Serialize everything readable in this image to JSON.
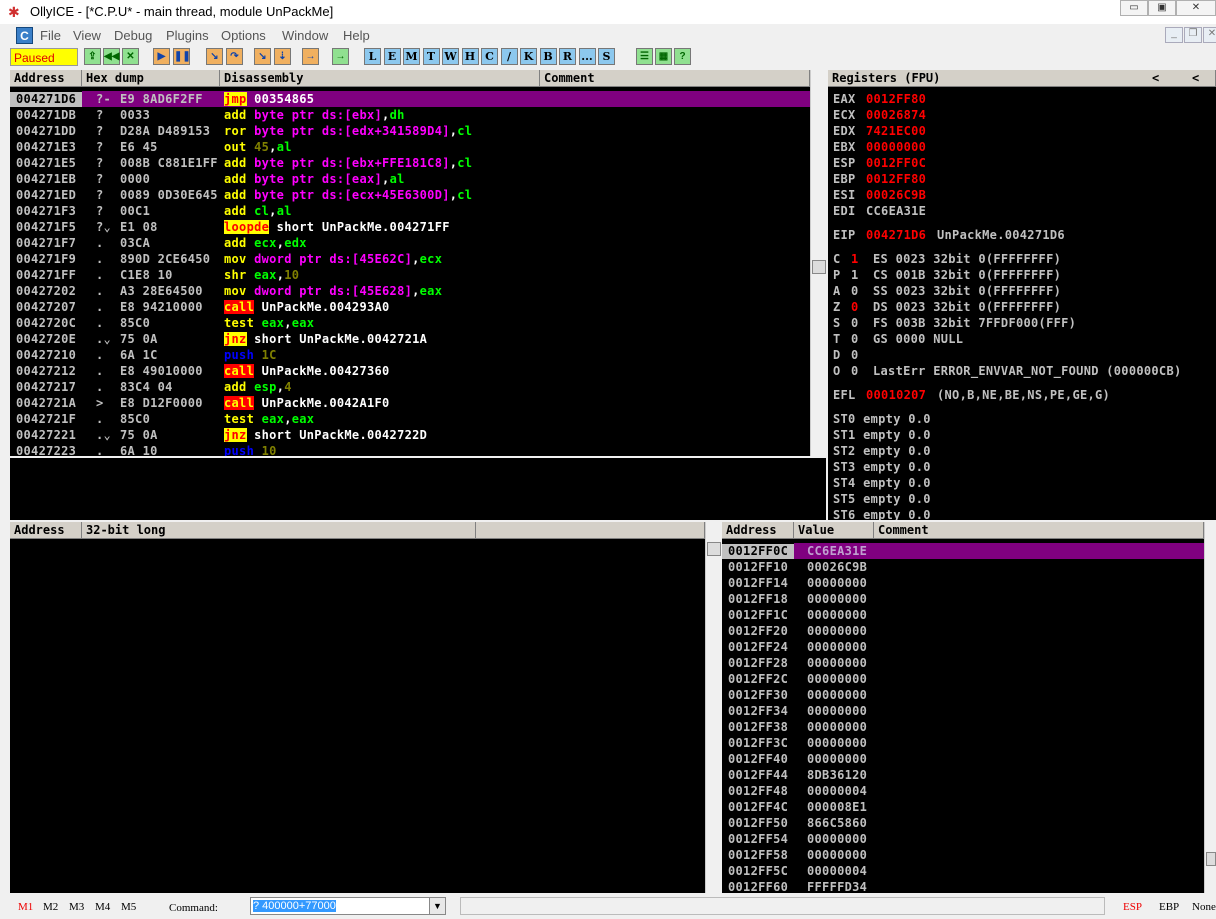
{
  "window": {
    "title": "OllyICE - [*C.P.U* - main thread, module UnPackMe]",
    "logo_icon": "bug-icon",
    "minimize": "minimize-icon",
    "maximize": "maximize-icon",
    "close": "close-icon"
  },
  "menu": {
    "items": [
      "File",
      "View",
      "Debug",
      "Plugins",
      "Options",
      "Window",
      "Help"
    ]
  },
  "toolbar": {
    "status": "Paused",
    "buttons": [
      "open",
      "restart",
      "close",
      "run",
      "pause",
      "step-into",
      "step-over",
      "trace-into",
      "trace-over",
      "execute-till-return",
      "goto-origin"
    ],
    "letter_buttons": [
      "L",
      "E",
      "M",
      "T",
      "W",
      "H",
      "C",
      "/",
      "K",
      "B",
      "R",
      "...",
      "S"
    ],
    "right_buttons": [
      "list",
      "colors",
      "help"
    ]
  },
  "disasm": {
    "headers": [
      "Address",
      "Hex dump",
      "Disassembly",
      "Comment"
    ],
    "rows": [
      {
        "addr": "004271D6",
        "flag": "?-",
        "hex": "E9 8AD6F2FF",
        "ins": [
          [
            "jmp",
            "hl"
          ],
          [
            " 00354865",
            "plain"
          ]
        ]
      },
      {
        "addr": "004271DB",
        "flag": "?",
        "hex": "0033",
        "ins": [
          [
            "add",
            "mnem"
          ],
          [
            " byte ptr ds:[ebx]",
            "mem"
          ],
          [
            ",",
            "plain"
          ],
          [
            "dh",
            "reg"
          ]
        ]
      },
      {
        "addr": "004271DD",
        "flag": "?",
        "hex": "D28A D489153",
        "ins": [
          [
            "ror",
            "mnem"
          ],
          [
            " byte ptr ds:[edx+341589D4]",
            "mem"
          ],
          [
            ",",
            "plain"
          ],
          [
            "cl",
            "reg"
          ]
        ]
      },
      {
        "addr": "004271E3",
        "flag": "?",
        "hex": "E6 45",
        "ins": [
          [
            "out",
            "mnem"
          ],
          [
            " 45",
            "const"
          ],
          [
            ",",
            "plain"
          ],
          [
            "al",
            "reg"
          ]
        ]
      },
      {
        "addr": "004271E5",
        "flag": "?",
        "hex": "008B C881E1FF",
        "ins": [
          [
            "add",
            "mnem"
          ],
          [
            " byte ptr ds:[ebx+FFE181C8]",
            "mem"
          ],
          [
            ",",
            "plain"
          ],
          [
            "cl",
            "reg"
          ]
        ]
      },
      {
        "addr": "004271EB",
        "flag": "?",
        "hex": "0000",
        "ins": [
          [
            "add",
            "mnem"
          ],
          [
            " byte ptr ds:[eax]",
            "mem"
          ],
          [
            ",",
            "plain"
          ],
          [
            "al",
            "reg"
          ]
        ]
      },
      {
        "addr": "004271ED",
        "flag": "?",
        "hex": "0089 0D30E645",
        "ins": [
          [
            "add",
            "mnem"
          ],
          [
            " byte ptr ds:[ecx+45E6300D]",
            "mem"
          ],
          [
            ",",
            "plain"
          ],
          [
            "cl",
            "reg"
          ]
        ]
      },
      {
        "addr": "004271F3",
        "flag": "?",
        "hex": "00C1",
        "ins": [
          [
            "add",
            "mnem"
          ],
          [
            " cl",
            "reg"
          ],
          [
            ",",
            "plain"
          ],
          [
            "al",
            "reg"
          ]
        ]
      },
      {
        "addr": "004271F5",
        "flag": "?⌄",
        "hex": "E1 08",
        "ins": [
          [
            "loopde",
            "hl"
          ],
          [
            " short UnPackMe.004271FF",
            "plain"
          ]
        ]
      },
      {
        "addr": "004271F7",
        "flag": ".",
        "hex": "03CA",
        "ins": [
          [
            "add",
            "mnem"
          ],
          [
            " ecx",
            "reg"
          ],
          [
            ",",
            "plain"
          ],
          [
            "edx",
            "reg"
          ]
        ]
      },
      {
        "addr": "004271F9",
        "flag": ".",
        "hex": "890D 2CE6450",
        "ins": [
          [
            "mov",
            "mnem"
          ],
          [
            " dword ptr ds:[45E62C]",
            "mem"
          ],
          [
            ",",
            "plain"
          ],
          [
            "ecx",
            "reg"
          ]
        ]
      },
      {
        "addr": "004271FF",
        "flag": ".",
        "hex": "C1E8 10",
        "ins": [
          [
            "shr",
            "mnem"
          ],
          [
            " eax",
            "reg"
          ],
          [
            ",",
            "plain"
          ],
          [
            "10",
            "const"
          ]
        ]
      },
      {
        "addr": "00427202",
        "flag": ".",
        "hex": "A3 28E64500",
        "ins": [
          [
            "mov",
            "mnem"
          ],
          [
            " dword ptr ds:[45E628]",
            "mem"
          ],
          [
            ",",
            "plain"
          ],
          [
            "eax",
            "reg"
          ]
        ]
      },
      {
        "addr": "00427207",
        "flag": ".",
        "hex": "E8 94210000",
        "ins": [
          [
            "call",
            "call"
          ],
          [
            " UnPackMe.004293A0",
            "plain"
          ]
        ]
      },
      {
        "addr": "0042720C",
        "flag": ".",
        "hex": "85C0",
        "ins": [
          [
            "test",
            "mnem"
          ],
          [
            " eax",
            "reg"
          ],
          [
            ",",
            "plain"
          ],
          [
            "eax",
            "reg"
          ]
        ]
      },
      {
        "addr": "0042720E",
        "flag": ".⌄",
        "hex": "75 0A",
        "ins": [
          [
            "jnz",
            "hl"
          ],
          [
            " short UnPackMe.0042721A",
            "plain"
          ]
        ]
      },
      {
        "addr": "00427210",
        "flag": ".",
        "hex": "6A 1C",
        "ins": [
          [
            "push",
            "push"
          ],
          [
            " 1C",
            "const"
          ]
        ]
      },
      {
        "addr": "00427212",
        "flag": ".",
        "hex": "E8 49010000",
        "ins": [
          [
            "call",
            "call"
          ],
          [
            " UnPackMe.00427360",
            "plain"
          ]
        ]
      },
      {
        "addr": "00427217",
        "flag": ".",
        "hex": "83C4 04",
        "ins": [
          [
            "add",
            "mnem"
          ],
          [
            " esp",
            "reg"
          ],
          [
            ",",
            "plain"
          ],
          [
            "4",
            "const"
          ]
        ]
      },
      {
        "addr": "0042721A",
        "flag": ">",
        "hex": "E8 D12F0000",
        "ins": [
          [
            "call",
            "call"
          ],
          [
            " UnPackMe.0042A1F0",
            "plain"
          ]
        ]
      },
      {
        "addr": "0042721F",
        "flag": ".",
        "hex": "85C0",
        "ins": [
          [
            "test",
            "mnem"
          ],
          [
            " eax",
            "reg"
          ],
          [
            ",",
            "plain"
          ],
          [
            "eax",
            "reg"
          ]
        ]
      },
      {
        "addr": "00427221",
        "flag": ".⌄",
        "hex": "75 0A",
        "ins": [
          [
            "jnz",
            "hl"
          ],
          [
            " short UnPackMe.0042722D",
            "plain"
          ]
        ]
      },
      {
        "addr": "00427223",
        "flag": ".",
        "hex": "6A 10",
        "ins": [
          [
            "push",
            "push"
          ],
          [
            " 10",
            "const"
          ]
        ]
      }
    ]
  },
  "registers": {
    "title": "Registers (FPU)",
    "nav": [
      "<",
      "<"
    ],
    "gp": [
      [
        "EAX",
        "0012FF80",
        true
      ],
      [
        "ECX",
        "00026874",
        true
      ],
      [
        "EDX",
        "7421EC00",
        true
      ],
      [
        "EBX",
        "00000000",
        true
      ],
      [
        "ESP",
        "0012FF0C",
        true
      ],
      [
        "EBP",
        "0012FF80",
        true
      ],
      [
        "ESI",
        "00026C9B",
        true
      ],
      [
        "EDI",
        "CC6EA31E",
        false
      ]
    ],
    "eip": {
      "name": "EIP",
      "value": "004271D6",
      "label": "UnPackMe.004271D6"
    },
    "flags": [
      [
        "C",
        "1",
        true,
        "ES 0023 32bit 0(FFFFFFFF)"
      ],
      [
        "P",
        "1",
        false,
        "CS 001B 32bit 0(FFFFFFFF)"
      ],
      [
        "A",
        "0",
        false,
        "SS 0023 32bit 0(FFFFFFFF)"
      ],
      [
        "Z",
        "0",
        true,
        "DS 0023 32bit 0(FFFFFFFF)"
      ],
      [
        "S",
        "0",
        false,
        "FS 003B 32bit 7FFDF000(FFF)"
      ],
      [
        "T",
        "0",
        false,
        "GS 0000 NULL"
      ],
      [
        "D",
        "0",
        false,
        ""
      ],
      [
        "O",
        "0",
        false,
        "LastErr ERROR_ENVVAR_NOT_FOUND (000000CB)"
      ]
    ],
    "efl": {
      "name": "EFL",
      "value": "00010207",
      "desc": "(NO,B,NE,BE,NS,PE,GE,G)"
    },
    "fpu": [
      "ST0 empty 0.0",
      "ST1 empty 0.0",
      "ST2 empty 0.0",
      "ST3 empty 0.0",
      "ST4 empty 0.0",
      "ST5 empty 0.0",
      "ST6 empty 0.0"
    ]
  },
  "dump": {
    "headers": [
      "Address",
      "32-bit long",
      ""
    ]
  },
  "stack": {
    "headers": [
      "Address",
      "Value",
      "Comment"
    ],
    "rows": [
      [
        "0012FF0C",
        "CC6EA31E"
      ],
      [
        "0012FF10",
        "00026C9B"
      ],
      [
        "0012FF14",
        "00000000"
      ],
      [
        "0012FF18",
        "00000000"
      ],
      [
        "0012FF1C",
        "00000000"
      ],
      [
        "0012FF20",
        "00000000"
      ],
      [
        "0012FF24",
        "00000000"
      ],
      [
        "0012FF28",
        "00000000"
      ],
      [
        "0012FF2C",
        "00000000"
      ],
      [
        "0012FF30",
        "00000000"
      ],
      [
        "0012FF34",
        "00000000"
      ],
      [
        "0012FF38",
        "00000000"
      ],
      [
        "0012FF3C",
        "00000000"
      ],
      [
        "0012FF40",
        "00000000"
      ],
      [
        "0012FF44",
        "8DB36120"
      ],
      [
        "0012FF48",
        "00000004"
      ],
      [
        "0012FF4C",
        "000008E1"
      ],
      [
        "0012FF50",
        "866C5860"
      ],
      [
        "0012FF54",
        "00000000"
      ],
      [
        "0012FF58",
        "00000000"
      ],
      [
        "0012FF5C",
        "00000004"
      ],
      [
        "0012FF60",
        "FFFFFD34"
      ]
    ]
  },
  "statusbar": {
    "marks": [
      "M1",
      "M2",
      "M3",
      "M4",
      "M5"
    ],
    "command_label": "Command:",
    "command_value": "? 400000+77000",
    "right": [
      "ESP",
      "EBP",
      "None"
    ]
  }
}
